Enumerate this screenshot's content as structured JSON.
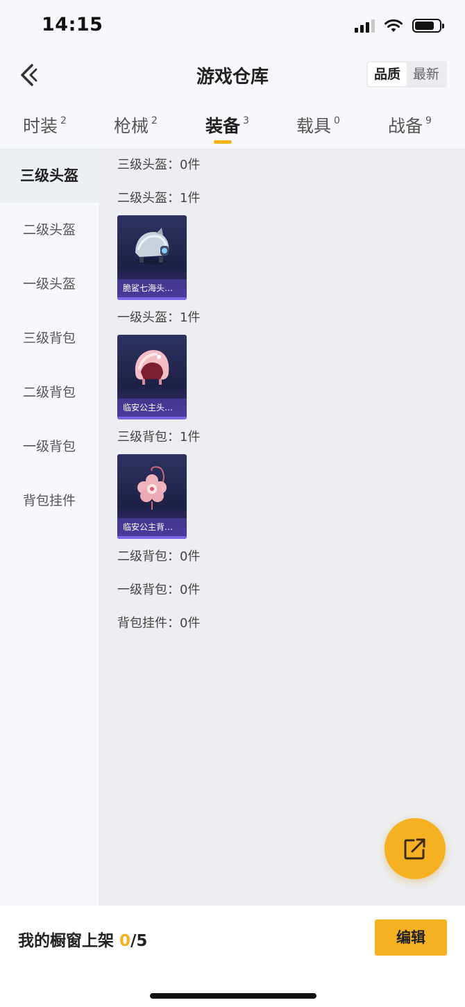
{
  "status_bar": {
    "time": "14:15",
    "battery_level": 0.8
  },
  "header": {
    "title": "游戏仓库",
    "sort_options": [
      "品质",
      "最新"
    ],
    "sort_selected": "品质"
  },
  "tabs": [
    {
      "label": "时装",
      "count": "2"
    },
    {
      "label": "枪械",
      "count": "2"
    },
    {
      "label": "装备",
      "count": "3"
    },
    {
      "label": "载具",
      "count": "0"
    },
    {
      "label": "战备",
      "count": "9"
    }
  ],
  "active_tab": "装备",
  "sidebar": {
    "items": [
      "三级头盔",
      "二级头盔",
      "一级头盔",
      "三级背包",
      "二级背包",
      "一级背包",
      "背包挂件"
    ],
    "active": "三级头盔"
  },
  "sections": [
    {
      "label": "三级头盔：0件",
      "items": []
    },
    {
      "label": "二级头盔：1件",
      "items": [
        {
          "name": "脆鲨七海头…",
          "icon": "shark-helmet-icon"
        }
      ]
    },
    {
      "label": "一级头盔：1件",
      "items": [
        {
          "name": "临安公主头…",
          "icon": "pink-helmet-icon"
        }
      ]
    },
    {
      "label": "三级背包：1件",
      "items": [
        {
          "name": "临安公主背…",
          "icon": "blossom-backpack-icon"
        }
      ]
    },
    {
      "label": "二级背包：0件",
      "items": []
    },
    {
      "label": "一级背包：0件",
      "items": []
    },
    {
      "label": "背包挂件：0件",
      "items": []
    }
  ],
  "bottom_bar": {
    "showcase_label": "我的橱窗上架",
    "showcase_current": "0",
    "showcase_total": "/5",
    "edit_label": "编辑"
  },
  "colors": {
    "accent": "#f5b122",
    "card_purple": "#7d66e6"
  },
  "fab_icon": "share-external-icon"
}
